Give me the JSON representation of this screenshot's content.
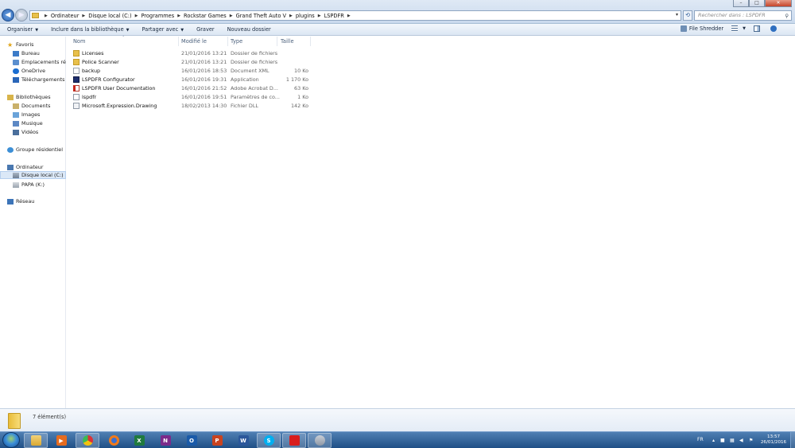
{
  "window": {
    "minimize": "–",
    "maximize": "□",
    "close": "✕"
  },
  "address": {
    "crumbs": [
      "Ordinateur",
      "Disque local (C:)",
      "Programmes",
      "Rockstar Games",
      "Grand Theft Auto V",
      "plugins",
      "LSPDFR"
    ]
  },
  "search": {
    "placeholder": "Rechercher dans : LSPDFR"
  },
  "toolbar": {
    "organize": "Organiser",
    "include": "Inclure dans la bibliothèque",
    "share": "Partager avec",
    "burn": "Graver",
    "new_folder": "Nouveau dossier",
    "file_shredder": "File Shredder"
  },
  "sidebar": {
    "favorites": "Favoris",
    "bureau": "Bureau",
    "recent": "Emplacements récents",
    "onedrive": "OneDrive",
    "downloads": "Téléchargements",
    "libraries": "Bibliothèques",
    "documents": "Documents",
    "images": "Images",
    "music": "Musique",
    "videos": "Vidéos",
    "homegroup": "Groupe résidentiel",
    "computer": "Ordinateur",
    "local_disk": "Disque local (C:)",
    "papa": "PAPA (K:)",
    "network": "Réseau"
  },
  "columns": {
    "name": "Nom",
    "modified": "Modifié le",
    "type": "Type",
    "size": "Taille"
  },
  "files": [
    {
      "name": "Licenses",
      "date": "21/01/2016 13:21",
      "type": "Dossier de fichiers",
      "size": "",
      "icon": "folder-icon"
    },
    {
      "name": "Police Scanner",
      "date": "21/01/2016 13:21",
      "type": "Dossier de fichiers",
      "size": "",
      "icon": "folder-icon"
    },
    {
      "name": "backup",
      "date": "16/01/2016 18:53",
      "type": "Document XML",
      "size": "10 Ko",
      "icon": "xml-file-icon"
    },
    {
      "name": "LSPDFR Configurator",
      "date": "16/01/2016 19:31",
      "type": "Application",
      "size": "1 170 Ko",
      "icon": "application-icon"
    },
    {
      "name": "LSPDFR User Documentation",
      "date": "16/01/2016 21:52",
      "type": "Adobe Acrobat D...",
      "size": "63 Ko",
      "icon": "pdf-icon"
    },
    {
      "name": "lspdfr",
      "date": "16/01/2016 19:51",
      "type": "Paramètres de co...",
      "size": "1 Ko",
      "icon": "config-file-icon"
    },
    {
      "name": "Microsoft.Expression.Drawing",
      "date": "18/02/2013 14:30",
      "type": "Fichier DLL",
      "size": "142 Ko",
      "icon": "dll-file-icon"
    }
  ],
  "status": {
    "count": "7 élément(s)"
  },
  "taskbar": {
    "language": "FR",
    "time": "13:57",
    "date": "26/01/2016"
  }
}
